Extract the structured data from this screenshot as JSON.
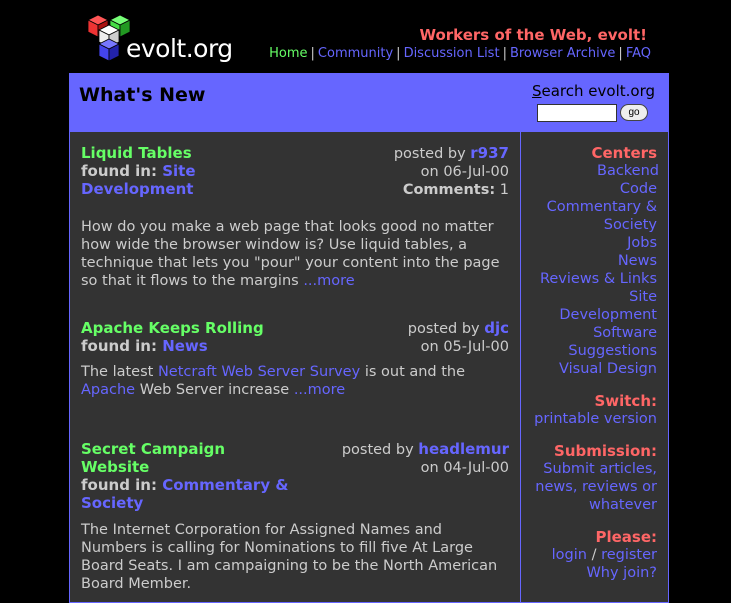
{
  "site": {
    "logo_text": "evolt.org",
    "tagline": "Workers of the Web, evolt!"
  },
  "colors": {
    "accent_blue": "#6666ff",
    "accent_green": "#66ff66",
    "accent_red": "#ff6666",
    "panel_bg": "#333333",
    "page_bg": "#000000",
    "text": "#cccccc"
  },
  "nav": {
    "home": "Home",
    "community": "Community",
    "discussion_list": "Discussion List",
    "browser_archive": "Browser Archive",
    "faq": "FAQ",
    "separator": "|"
  },
  "header": {
    "title": "What's New",
    "search_label_first": "S",
    "search_label_rest": "earch evolt.org",
    "search_value": "",
    "go_label": "go"
  },
  "articles": [
    {
      "title": "Liquid Tables",
      "found_label": "found in:",
      "category": "Site Development",
      "posted_by_label": "posted by",
      "author": "r937",
      "date": "on 06-Jul-00",
      "comments_label": "Comments:",
      "comments": "1",
      "summary": "How do you make a web page that looks good no matter how wide the browser window is? Use liquid tables, a technique that lets you \"pour\" your content into the page so that it flows to the margins",
      "more": "...more"
    },
    {
      "title": "Apache Keeps Rolling",
      "found_label": "found in:",
      "category": "News",
      "posted_by_label": "posted by",
      "author": "djc",
      "date": "on 05-Jul-00",
      "summary_prefix": "The latest",
      "link1": "Netcraft Web Server Survey",
      "summary_middle": "is out and the",
      "link2": "Apache",
      "summary_suffix": "Web Server increase",
      "more": "...more"
    },
    {
      "title": "Secret Campaign Website",
      "found_label": "found in:",
      "category": "Commentary & Society",
      "posted_by_label": "posted by",
      "author": "headlemur",
      "date": "on 04-Jul-00",
      "summary": "The Internet Corporation for Assigned Names and Numbers is calling for Nominations to fill five At Large Board Seats. I am campaigning to be the North American Board Member."
    }
  ],
  "sidebar": {
    "centers_heading": "Centers",
    "centers": [
      "Backend Code",
      "Commentary & Society",
      "Jobs",
      "News",
      "Reviews & Links",
      "Site Development",
      "Software",
      "Suggestions",
      "Visual Design"
    ],
    "switch_heading": "Switch:",
    "switch_link": "printable version",
    "submission_heading": "Submission:",
    "submission_link": "Submit articles, news, reviews or whatever",
    "please_heading": "Please:",
    "login": "login",
    "slash": "/",
    "register": "register",
    "why_join": "Why join?"
  }
}
